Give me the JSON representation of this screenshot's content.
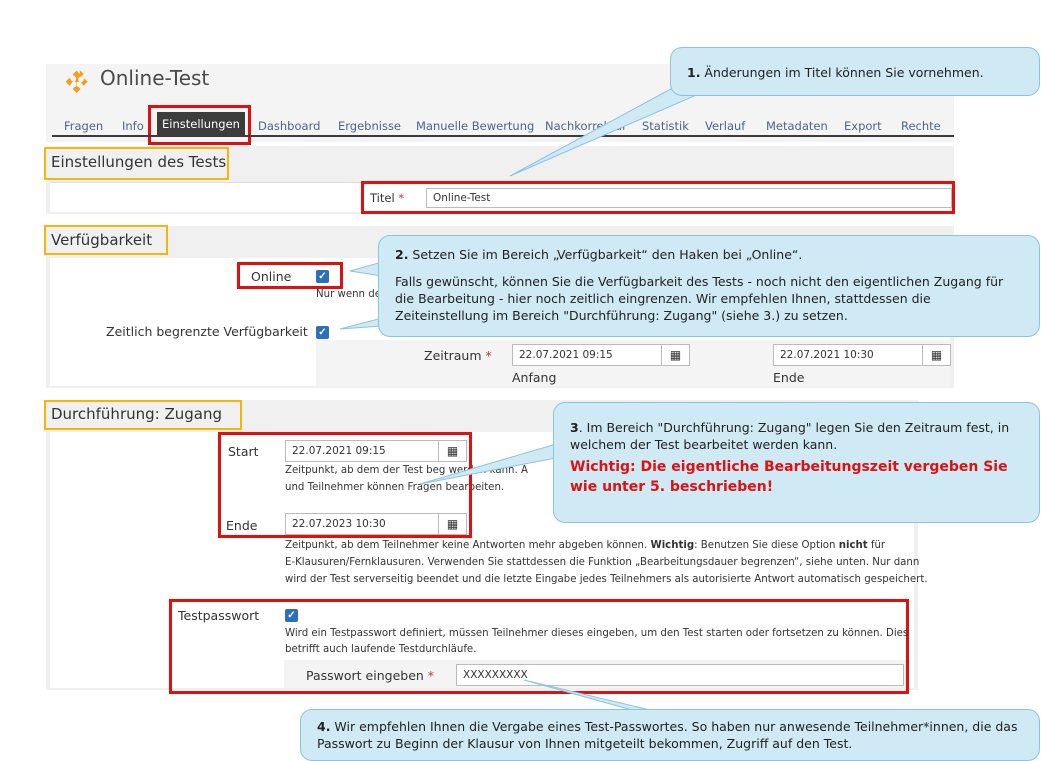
{
  "header": {
    "title": "Online-Test"
  },
  "tabs": [
    "Fragen",
    "Info",
    "Einstellungen",
    "Dashboard",
    "Ergebnisse",
    "Manuelle Bewertung",
    "Nachkorrektur",
    "Statistik",
    "Verlauf",
    "Metadaten",
    "Export",
    "Rechte"
  ],
  "active_tab": "Einstellungen",
  "sections": {
    "settings": {
      "title": "Einstellungen des Tests",
      "title_label": "Titel",
      "required_mark": "*",
      "title_value": "Online-Test"
    },
    "availability": {
      "title": "Verfügbarkeit",
      "online_label": "Online",
      "online_hint": "Nur wenn de",
      "limited_label": "Zeitlich begrenzte Verfügbarkeit",
      "period_label": "Zeitraum",
      "start_value": "22.07.2021 09:15",
      "end_value": "22.07.2021 10:30",
      "start_caption": "Anfang",
      "end_caption": "Ende"
    },
    "access": {
      "title": "Durchführung: Zugang",
      "start_label": "Start",
      "start_value": "22.07.2021 09:15",
      "start_hint_1": "Zeitpunkt, ab dem der Test beg",
      "start_hint_1b": "werden kann. A",
      "start_hint_2": "und Teilnehmer können Fragen bearbeiten.",
      "end_label": "Ende",
      "end_value": "22.07.2023 10:30",
      "end_hint_1a": "Zeitpunkt, ab dem Teilnehmer keine Antworten mehr abgeben können. ",
      "end_hint_1b": "Wichtig",
      "end_hint_1c": ": Benutzen Sie diese Option ",
      "end_hint_1d": "nicht",
      "end_hint_1e": " für",
      "end_hint_2": "E-Klausuren/Fernklausuren. Verwenden Sie stattdessen die Funktion „Bearbeitungsdauer begrenzen“, siehe unten. Nur dann",
      "end_hint_3": "wird der Test serverseitig beendet und die letzte Eingabe jedes Teilnehmers als autorisierte Antwort automatisch gespeichert.",
      "password_label": "Testpasswort",
      "password_hint_1": "Wird ein Testpasswort definiert, müssen Teilnehmer dieses eingeben, um den Test starten oder fortsetzen zu können. Dies",
      "password_hint_2": "betrifft auch laufende Testdurchläufe.",
      "password_input_label": "Passwort eingeben",
      "password_value": "XXXXXXXXX"
    }
  },
  "callouts": {
    "c1": {
      "num": "1.",
      "text": " Änderungen im Titel können Sie vornehmen."
    },
    "c2": {
      "num": "2.",
      "line1": " Setzen Sie im Bereich „Verfügbarkeit“ den Haken bei „Online“.",
      "line2": "Falls gewünscht, können Sie die Verfügbarkeit des Tests - noch nicht den eigentlichen Zugang für die Bearbeitung - hier noch zeitlich eingrenzen. Wir empfehlen Ihnen, stattdessen die Zeiteinstellung im Bereich \"Durchführung: Zugang\" (siehe 3.) zu setzen."
    },
    "c3": {
      "num": "3",
      "line1": ". Im Bereich \"Durchführung: Zugang\" legen Sie den Zeitraum fest, in welchem der Test bearbeitet werden kann.",
      "warning": "Wichtig: Die eigentliche Bearbeitungszeit vergeben Sie wie unter 5. beschrieben!"
    },
    "c4": {
      "num": "4.",
      "text": " Wir empfehlen Ihnen die Vergabe eines Test-Passwortes. So haben nur anwesende Teilnehmer*innen, die das Passwort zu Beginn der Klausur von Ihnen mitgeteilt bekommen, Zugriff auf den Test."
    }
  },
  "colors": {
    "highlight_red": "#e01010",
    "highlight_yellow": "#f5b50a",
    "callout_bg": "#cfe9f5",
    "checkbox_blue": "#2d6fb8",
    "icon_orange": "#f0a020"
  },
  "icons": [
    "puzzle-icon",
    "calendar-icon",
    "checkbox-checked-icon"
  ]
}
